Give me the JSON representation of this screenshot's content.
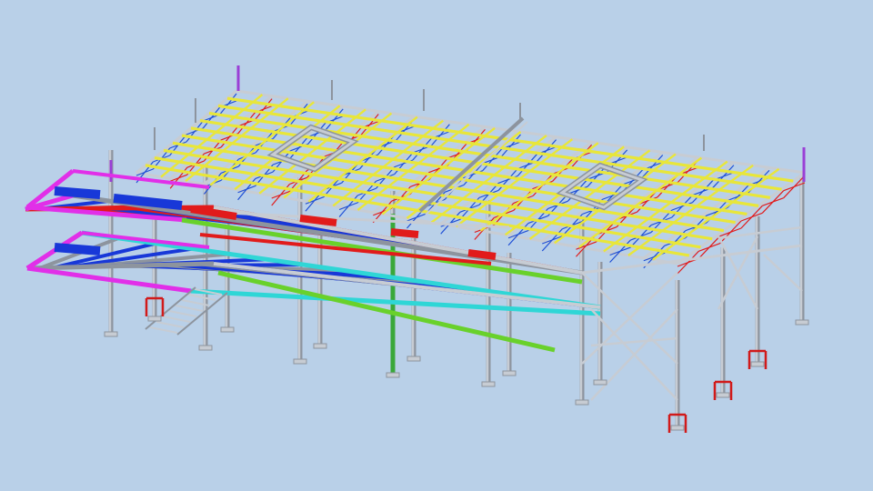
{
  "scene": {
    "background": "#b9d0e8",
    "colors": {
      "steel": "#c7ccd3",
      "steel_dark": "#8d949e",
      "purlin_yellow": "#e8e63a",
      "truss_blue": "#1f4fd6",
      "beam_red": "#e11b1b",
      "beam_blue": "#1838d8",
      "beam_green": "#69d12b",
      "magenta": "#e12fe8",
      "cyan": "#2fd6d6",
      "column_green": "#3aa83a",
      "base_red": "#d11a1a",
      "purple": "#9a3fd6"
    },
    "icons": [
      "steel-structure-model"
    ]
  }
}
